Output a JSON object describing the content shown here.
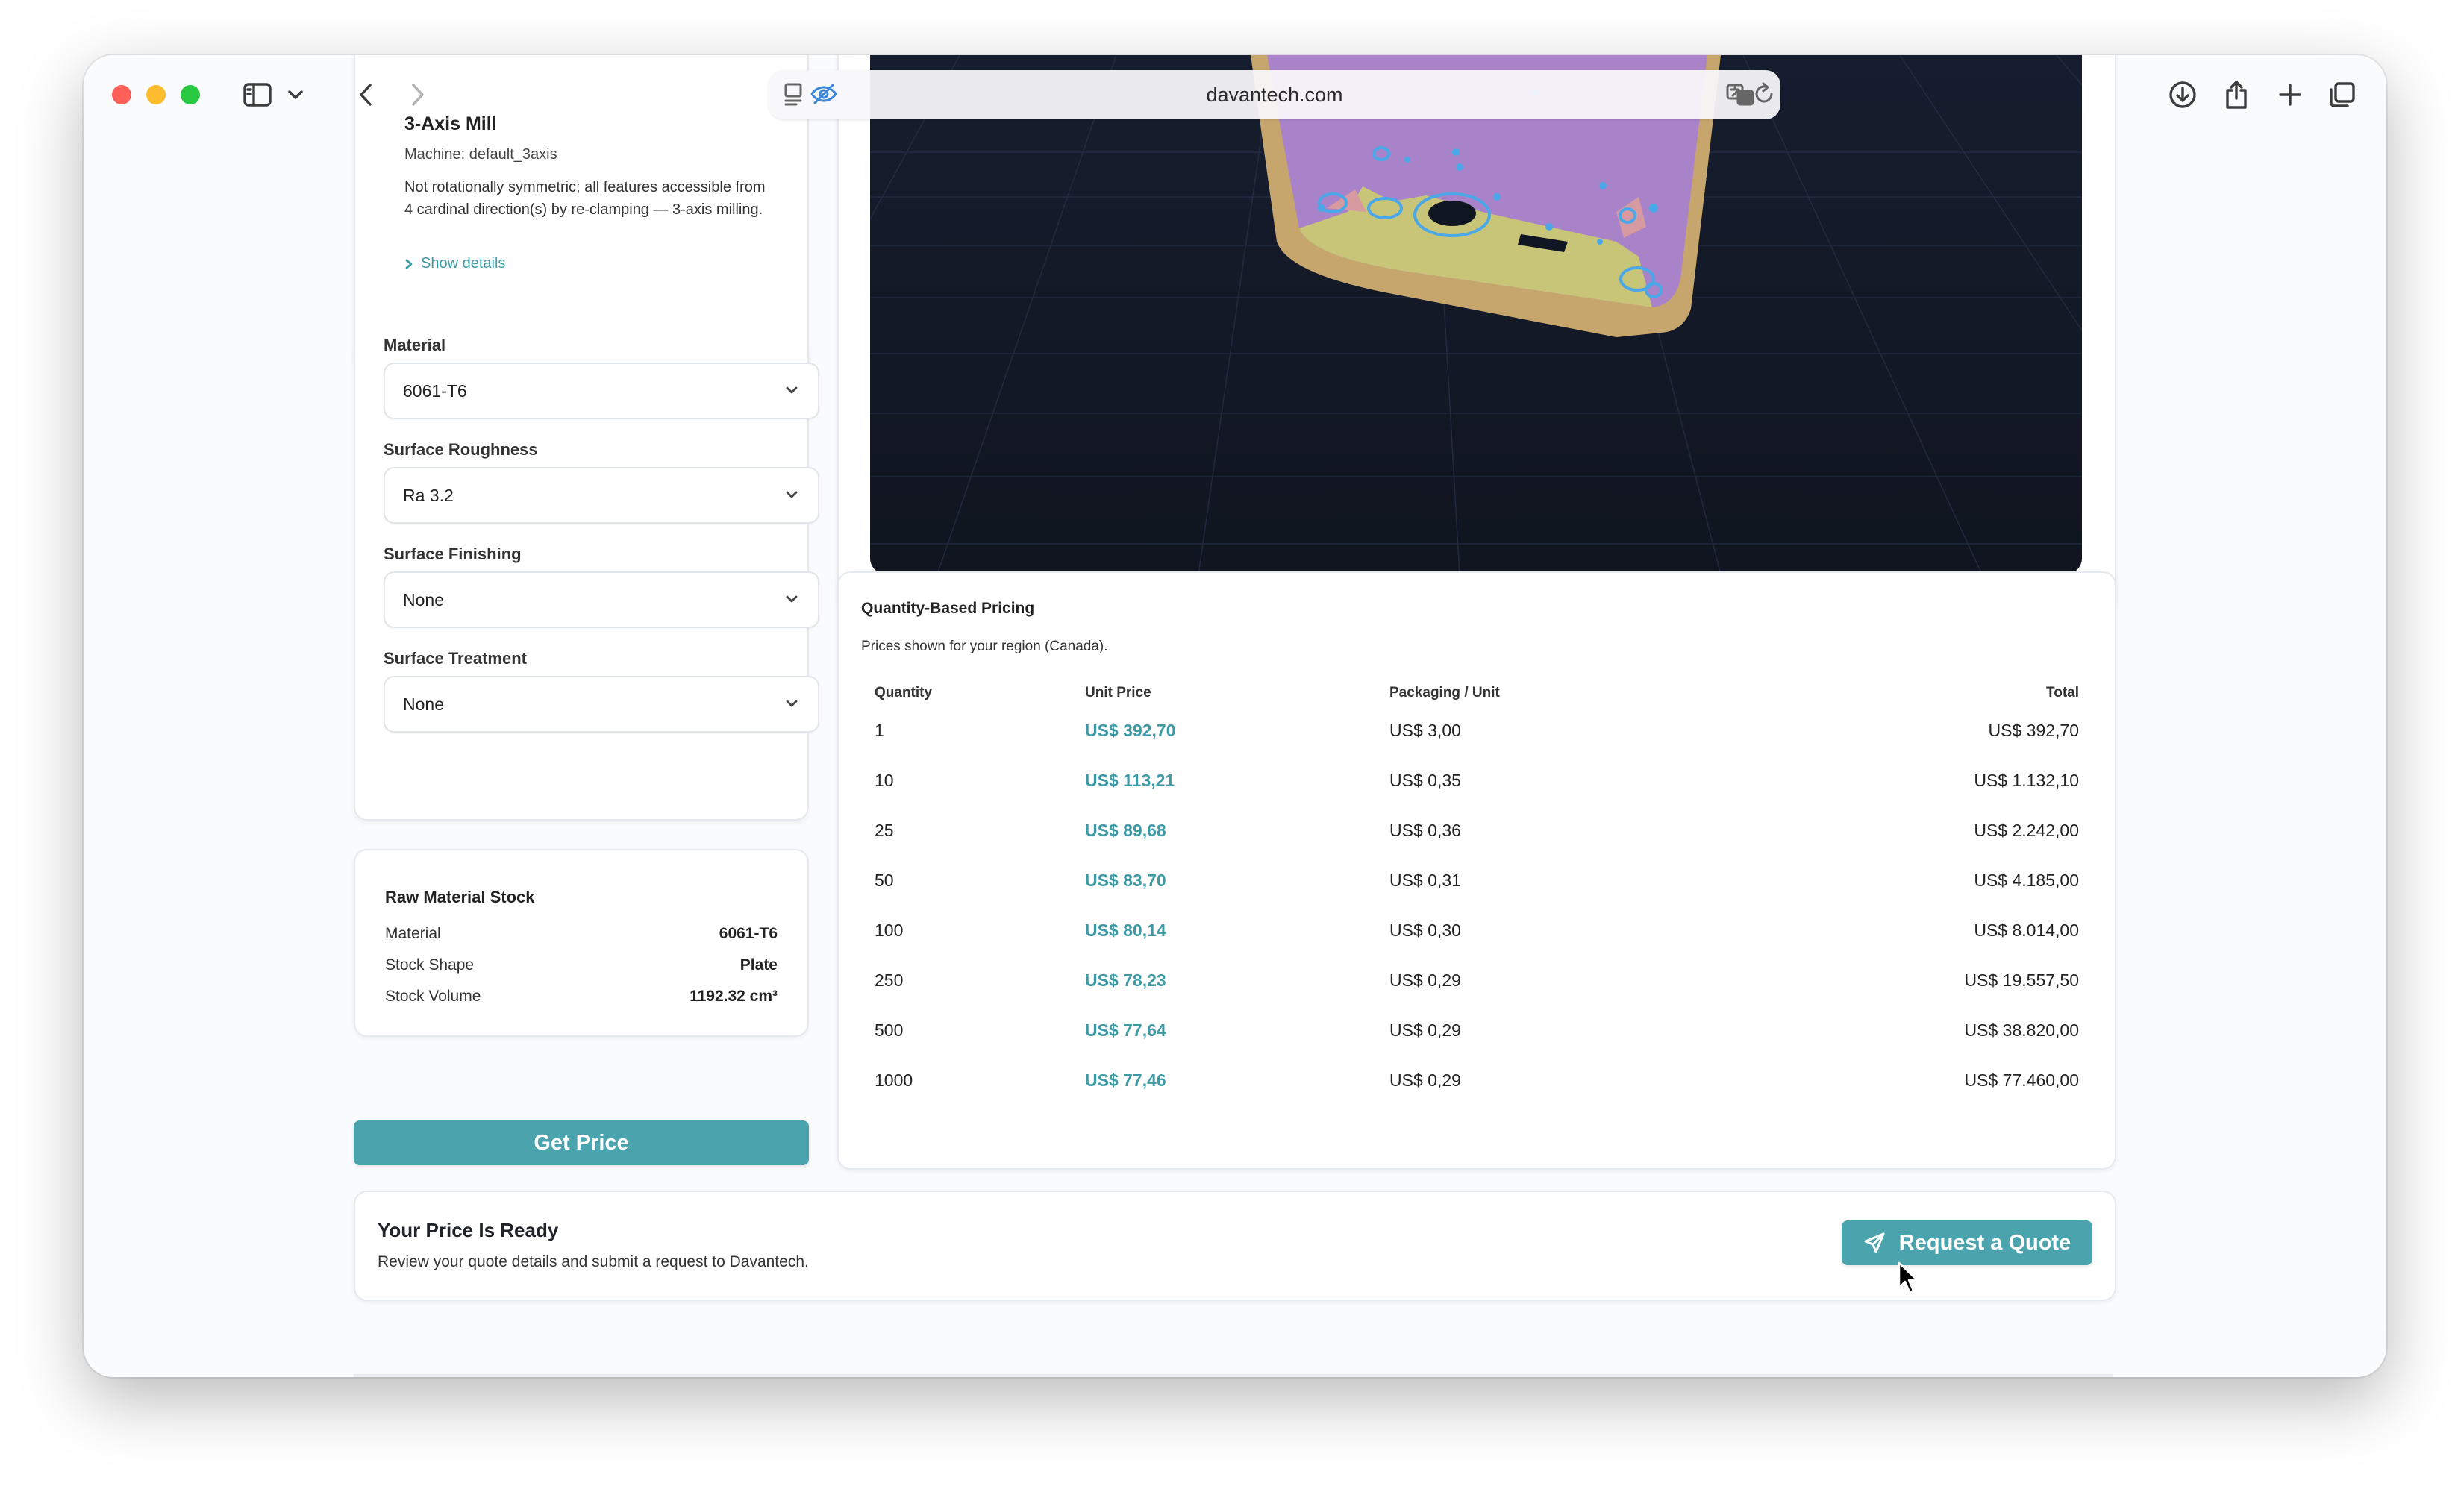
{
  "browser": {
    "url": "davantech.com",
    "icons": [
      "sidebar-icon",
      "chevron-down-icon",
      "back-icon",
      "forward-icon",
      "reader-icon",
      "privacy-eye-icon",
      "translate-icon",
      "reload-icon",
      "download-icon",
      "share-icon",
      "new-tab-icon",
      "tabs-overview-icon"
    ]
  },
  "process": {
    "title": "3-Axis Mill",
    "machine": "Machine: default_3axis",
    "description": "Not rotationally symmetric; all features accessible from 4 cardinal direction(s) by re-clamping — 3-axis milling.",
    "show_details": "Show details"
  },
  "fields": {
    "material": {
      "label": "Material",
      "value": "6061-T6"
    },
    "roughness": {
      "label": "Surface Roughness",
      "value": "Ra 3.2"
    },
    "finishing": {
      "label": "Surface Finishing",
      "value": "None"
    },
    "treatment": {
      "label": "Surface Treatment",
      "value": "None"
    }
  },
  "stock": {
    "title": "Raw Material Stock",
    "rows": [
      {
        "label": "Material",
        "value": "6061-T6"
      },
      {
        "label": "Stock Shape",
        "value": "Plate"
      },
      {
        "label": "Stock Volume",
        "value": "1192.32 cm³"
      }
    ]
  },
  "get_price_label": "Get Price",
  "pricing": {
    "title": "Quantity-Based Pricing",
    "subtitle": "Prices shown for your region (Canada).",
    "headers": {
      "quantity": "Quantity",
      "unit": "Unit Price",
      "packaging": "Packaging / Unit",
      "total": "Total"
    },
    "rows": [
      {
        "qty": "1",
        "unit": "US$ 392,70",
        "pack": "US$ 3,00",
        "total": "US$ 392,70"
      },
      {
        "qty": "10",
        "unit": "US$ 113,21",
        "pack": "US$ 0,35",
        "total": "US$ 1.132,10"
      },
      {
        "qty": "25",
        "unit": "US$ 89,68",
        "pack": "US$ 0,36",
        "total": "US$ 2.242,00"
      },
      {
        "qty": "50",
        "unit": "US$ 83,70",
        "pack": "US$ 0,31",
        "total": "US$ 4.185,00"
      },
      {
        "qty": "100",
        "unit": "US$ 80,14",
        "pack": "US$ 0,30",
        "total": "US$ 8.014,00"
      },
      {
        "qty": "250",
        "unit": "US$ 78,23",
        "pack": "US$ 0,29",
        "total": "US$ 19.557,50"
      },
      {
        "qty": "500",
        "unit": "US$ 77,64",
        "pack": "US$ 0,29",
        "total": "US$ 38.820,00"
      },
      {
        "qty": "1000",
        "unit": "US$ 77,46",
        "pack": "US$ 0,29",
        "total": "US$ 77.460,00"
      }
    ]
  },
  "ready": {
    "title": "Your Price Is Ready",
    "description": "Review your quote details and submit a request to Davantech.",
    "button": "Request a Quote"
  },
  "colors": {
    "accent": "#4aa3ad",
    "viewer_bg": "#141a2a",
    "part": "#a883c9"
  }
}
